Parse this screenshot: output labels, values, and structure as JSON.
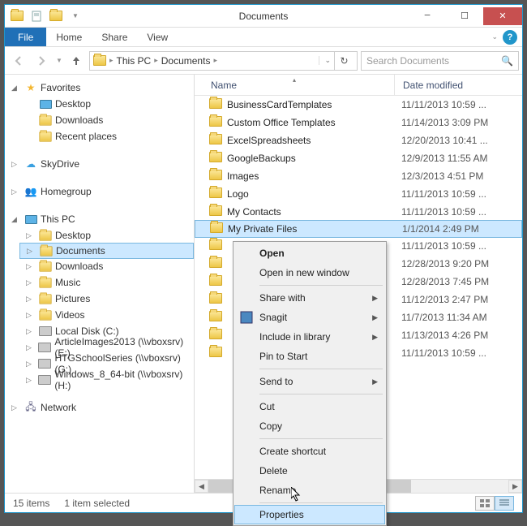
{
  "title": "Documents",
  "ribbon": {
    "file": "File",
    "home": "Home",
    "share": "Share",
    "view": "View"
  },
  "breadcrumb": {
    "root": "This PC",
    "current": "Documents"
  },
  "search": {
    "placeholder": "Search Documents"
  },
  "nav": {
    "favorites": {
      "label": "Favorites",
      "items": [
        "Desktop",
        "Downloads",
        "Recent places"
      ]
    },
    "skydrive": {
      "label": "SkyDrive"
    },
    "homegroup": {
      "label": "Homegroup"
    },
    "thispc": {
      "label": "This PC",
      "items": [
        "Desktop",
        "Documents",
        "Downloads",
        "Music",
        "Pictures",
        "Videos",
        "Local Disk (C:)",
        "ArticleImages2013 (\\\\vboxsrv) (E:)",
        "HTGSchoolSeries (\\\\vboxsrv) (G:)",
        "Windows_8_64-bit (\\\\vboxsrv) (H:)"
      ]
    },
    "network": {
      "label": "Network"
    }
  },
  "columns": {
    "name": "Name",
    "date": "Date modified"
  },
  "files": [
    {
      "name": "BusinessCardTemplates",
      "date": "11/11/2013 10:59 ..."
    },
    {
      "name": "Custom Office Templates",
      "date": "11/14/2013 3:09 PM"
    },
    {
      "name": "ExcelSpreadsheets",
      "date": "12/20/2013 10:41 ..."
    },
    {
      "name": "GoogleBackups",
      "date": "12/9/2013 11:55 AM"
    },
    {
      "name": "Images",
      "date": "12/3/2013 4:51 PM"
    },
    {
      "name": "Logo",
      "date": "11/11/2013 10:59 ..."
    },
    {
      "name": "My Contacts",
      "date": "11/11/2013 10:59 ..."
    },
    {
      "name": "My Private Files",
      "date": "1/1/2014 2:49 PM"
    },
    {
      "name": "",
      "date": "11/11/2013 10:59 ..."
    },
    {
      "name": "",
      "date": "12/28/2013 9:20 PM"
    },
    {
      "name": "",
      "date": "12/28/2013 7:45 PM"
    },
    {
      "name": "",
      "date": "11/12/2013 2:47 PM"
    },
    {
      "name": "",
      "date": "11/7/2013 11:34 AM"
    },
    {
      "name": "",
      "date": "11/13/2013 4:26 PM"
    },
    {
      "name": "",
      "date": "11/11/2013 10:59 ..."
    }
  ],
  "context_menu": {
    "open": "Open",
    "open_new": "Open in new window",
    "share_with": "Share with",
    "snagit": "Snagit",
    "include_lib": "Include in library",
    "pin_start": "Pin to Start",
    "send_to": "Send to",
    "cut": "Cut",
    "copy": "Copy",
    "create_shortcut": "Create shortcut",
    "delete": "Delete",
    "rename": "Rename",
    "properties": "Properties"
  },
  "status": {
    "count": "15 items",
    "selected": "1 item selected"
  }
}
